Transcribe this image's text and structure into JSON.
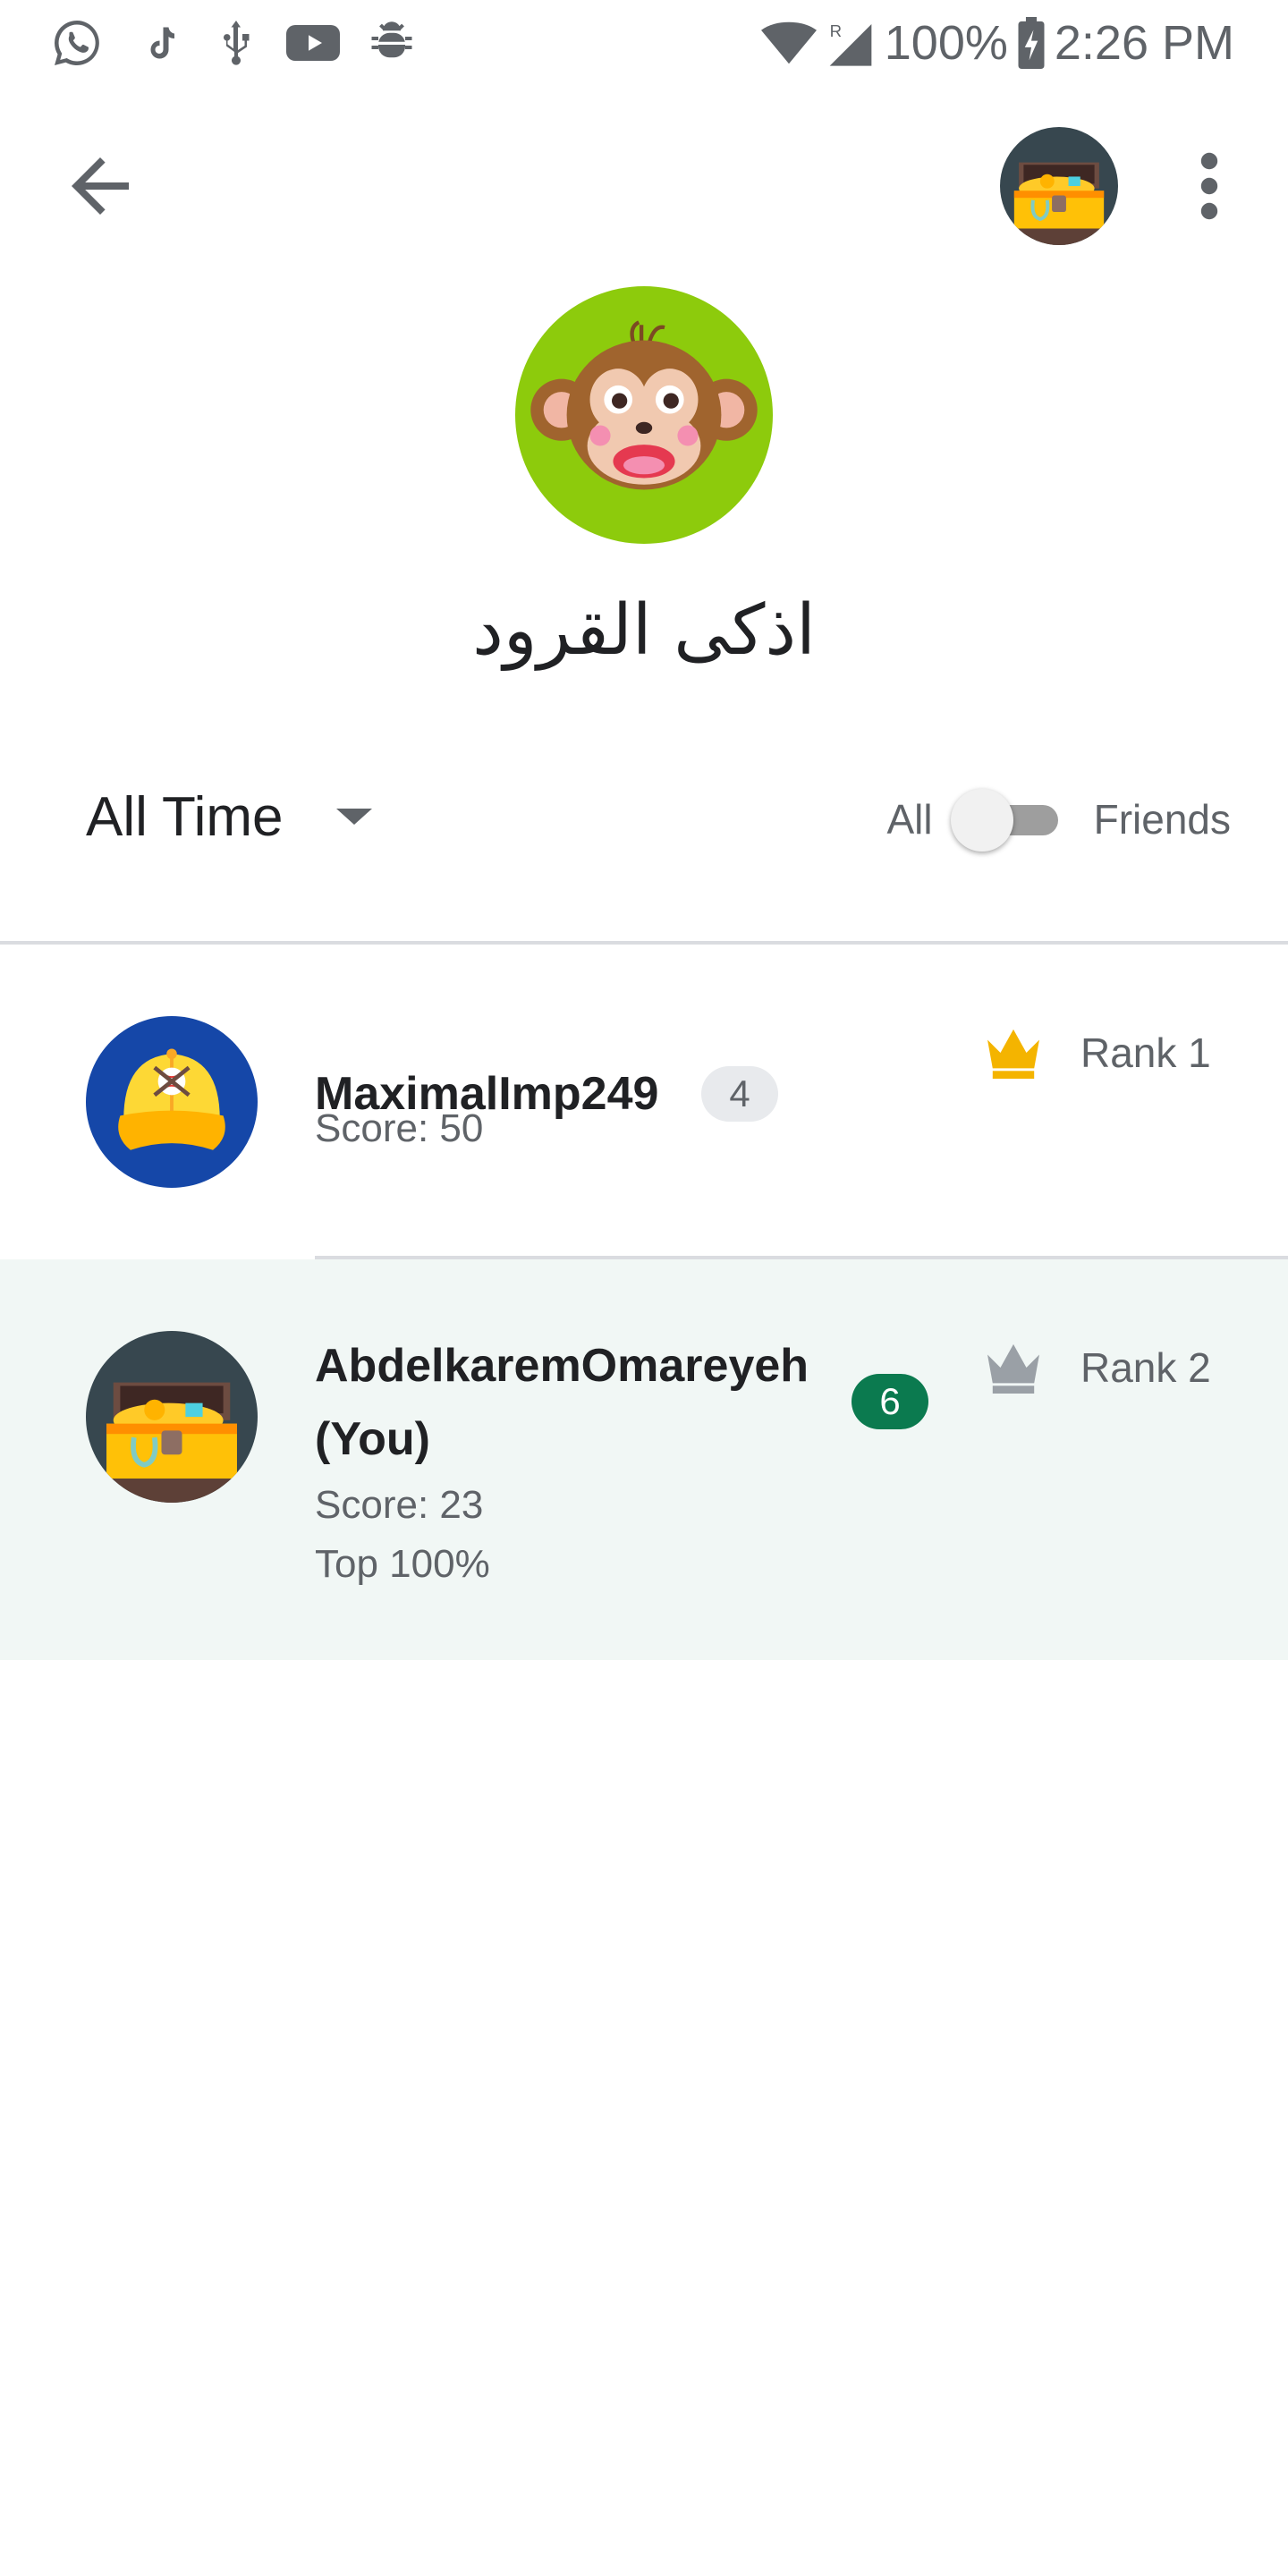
{
  "status_bar": {
    "battery": "100%",
    "time": "2:26 PM",
    "left_icons": [
      "whatsapp-icon",
      "tiktok-icon",
      "usb-icon",
      "youtube-icon",
      "bug-icon"
    ],
    "right_icons": [
      "wifi-icon",
      "signal-roaming-icon",
      "battery-charging-icon"
    ]
  },
  "app_bar": {
    "back_icon": "arrow-back-icon",
    "profile_avatar": "treasure-chest-avatar",
    "menu_icon": "more-vert-icon"
  },
  "group": {
    "avatar": "monkey-avatar",
    "avatar_color": "#8dcb0c",
    "title": "اذكى القرود"
  },
  "filters": {
    "period": "All Time",
    "toggle_left": "All",
    "toggle_right": "Friends"
  },
  "leaderboard": [
    {
      "name": "MaximalImp249",
      "level": "4",
      "score": "Score: 50",
      "rank": "Rank 1",
      "avatar": "baseball-cap-avatar",
      "crown_color": "#f4b400"
    },
    {
      "name": "AbdelkaremOmareyeh",
      "name_suffix": "(You)",
      "level": "6",
      "score": "Score: 23",
      "percentile": "Top 100%",
      "rank": "Rank 2",
      "avatar": "treasure-chest-avatar",
      "crown_color": "#9aa0a6",
      "badge_color": "#0b7a4f"
    }
  ]
}
